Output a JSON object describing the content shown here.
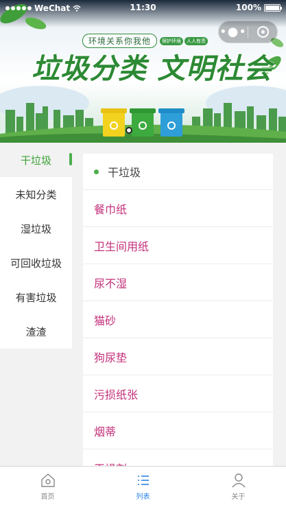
{
  "status_bar": {
    "carrier": "WeChat",
    "time": "11:30",
    "battery": "100%"
  },
  "banner": {
    "subtitle": "环境关系你我他",
    "title": "垃圾分类 文明社会",
    "tags": [
      "保护环境",
      "人人有责"
    ]
  },
  "sidebar": {
    "items": [
      {
        "label": "干垃圾",
        "active": true
      },
      {
        "label": "未知分类",
        "active": false
      },
      {
        "label": "湿垃圾",
        "active": false
      },
      {
        "label": "可回收垃圾",
        "active": false
      },
      {
        "label": "有害垃圾",
        "active": false
      },
      {
        "label": "渣渣",
        "active": false
      }
    ]
  },
  "list": {
    "header": "干垃圾",
    "items": [
      "餐巾纸",
      "卫生间用纸",
      "尿不湿",
      "猫砂",
      "狗尿垫",
      "污损纸张",
      "烟蒂",
      "干燥剂"
    ]
  },
  "tabbar": {
    "tabs": [
      {
        "label": "首页",
        "icon": "home-icon",
        "active": false
      },
      {
        "label": "列表",
        "icon": "list-icon",
        "active": true
      },
      {
        "label": "关于",
        "icon": "user-icon",
        "active": false
      }
    ]
  },
  "colors": {
    "accent_green": "#4cae4c",
    "item_text": "#c4307a",
    "tab_active": "#2a82e4"
  }
}
